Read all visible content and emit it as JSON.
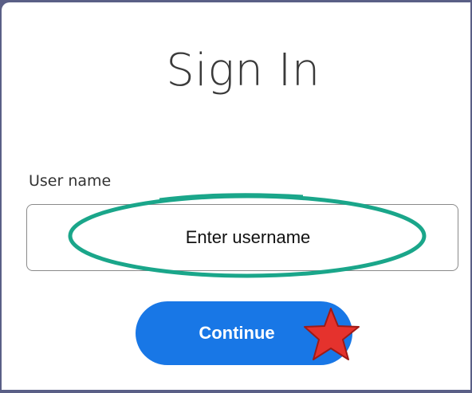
{
  "signin": {
    "title": "Sign In",
    "username_label": "User name",
    "username_placeholder": "Enter username",
    "continue_label": "Continue"
  },
  "colors": {
    "button": "#1877e6",
    "annotation_ellipse": "#1aa68a",
    "annotation_star": "#e5322d",
    "backdrop": "#5a5f86"
  },
  "icons": {
    "annotation_star": "star-icon"
  }
}
